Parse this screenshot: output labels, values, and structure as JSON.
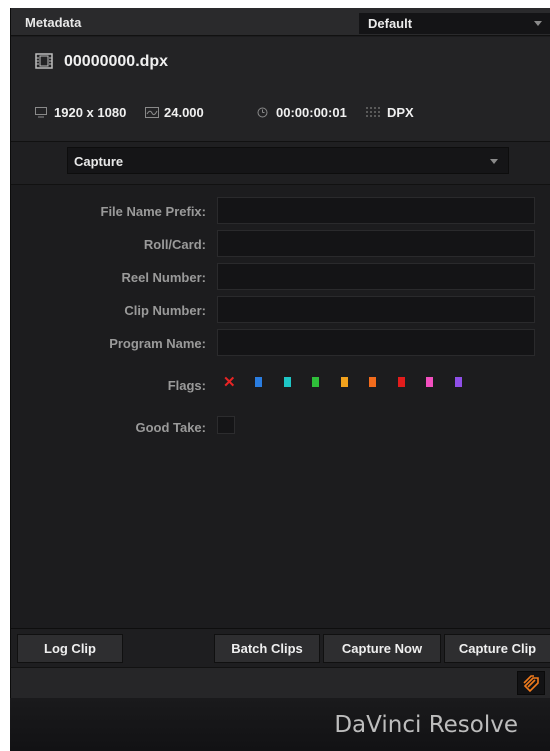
{
  "panel": {
    "title": "Metadata",
    "preset": "Default"
  },
  "clip": {
    "filename": "00000000.dpx",
    "resolution": "1920 x 1080",
    "framerate": "24.000",
    "timecode": "00:00:00:01",
    "format": "DPX"
  },
  "capture": {
    "selected": "Capture"
  },
  "fields": [
    {
      "label": "File Name Prefix:",
      "value": ""
    },
    {
      "label": "Roll/Card:",
      "value": ""
    },
    {
      "label": "Reel Number:",
      "value": ""
    },
    {
      "label": "Clip Number:",
      "value": ""
    },
    {
      "label": "Program Name:",
      "value": ""
    }
  ],
  "flags": {
    "label": "Flags:",
    "colors": [
      "#2a7de1",
      "#1ec6c6",
      "#2fbf3a",
      "#f2a21c",
      "#f26b1c",
      "#e21c1c",
      "#f24fbf",
      "#8f4fe8"
    ],
    "clear_color": "#e82424"
  },
  "good_take": {
    "label": "Good Take:",
    "checked": false
  },
  "buttons": {
    "log_clip": "Log Clip",
    "batch_clips": "Batch Clips",
    "capture_now": "Capture Now",
    "capture_clip": "Capture Clip"
  },
  "brand": "DaVinci Resolve"
}
